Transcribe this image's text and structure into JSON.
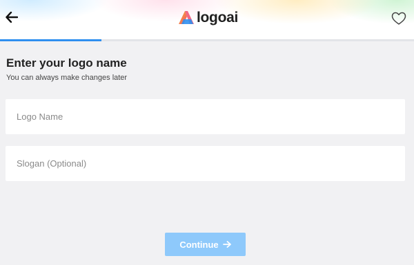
{
  "header": {
    "logo_text": "logoai",
    "back_icon": "arrow-left-icon",
    "favorite_icon": "heart-outline-icon",
    "logo_colors": [
      "#f04e6e",
      "#f7b32b",
      "#2f8ff0"
    ]
  },
  "progress": {
    "fraction": 0.245,
    "color": "#2f8ff0"
  },
  "main": {
    "title": "Enter your logo name",
    "subtitle": "You can always make changes later",
    "logo_name_placeholder": "Logo Name",
    "logo_name_value": "",
    "slogan_placeholder": "Slogan (Optional)",
    "slogan_value": "",
    "continue_label": "Continue",
    "continue_icon": "arrow-right-icon",
    "accent_disabled": "#8ec9fb"
  }
}
